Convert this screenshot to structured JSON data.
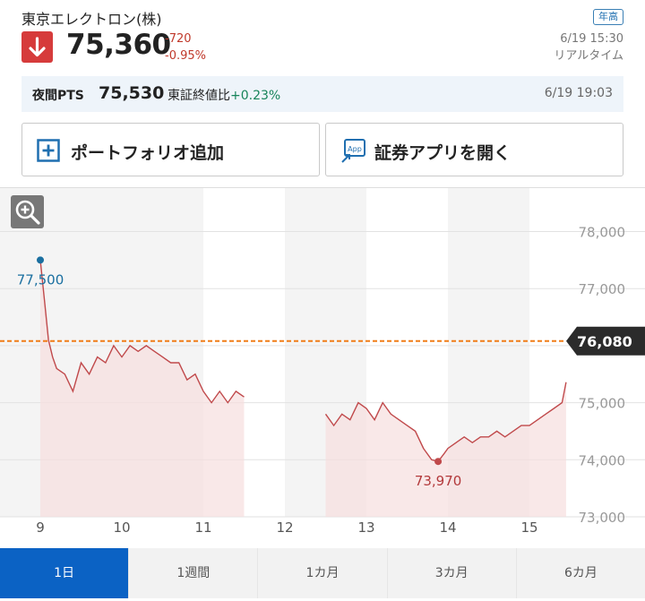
{
  "stock": {
    "name": "東京エレクトロン(株)",
    "badge": "年高",
    "price": "75,360",
    "change": "-720",
    "change_pct": "-0.95%",
    "date": "6/19 15:30",
    "realtime": "リアルタイム"
  },
  "pts": {
    "label": "夜間PTS",
    "price": "75,530",
    "compare_label": "東証終値比",
    "compare_value": "+0.23%",
    "datetime": "6/19 19:03"
  },
  "buttons": {
    "portfolio": "ポートフォリオ追加",
    "app": "証券アプリを開く",
    "app_icon_text": "App"
  },
  "colors": {
    "down": "#d63b3b",
    "up": "#17845a",
    "accent": "#0b62c4",
    "line": "#c0494b",
    "ref": "#f07d18"
  },
  "chart_data": {
    "type": "line",
    "x_labels": [
      "9",
      "10",
      "11",
      "12",
      "13",
      "14",
      "15"
    ],
    "y_ticks": [
      78000,
      77000,
      76000,
      75000,
      74000,
      73000
    ],
    "y_tick_labels": [
      "78,000",
      "77,000",
      "",
      "75,000",
      "74,000",
      "73,000"
    ],
    "ylim": [
      73000,
      78400
    ],
    "reference_line": {
      "value": 76080,
      "label": "76,080"
    },
    "high": {
      "value": 77500,
      "label": "77,500",
      "x": 9.0
    },
    "low": {
      "value": 73970,
      "label": "73,970",
      "x": 13.88
    },
    "morning_session": [
      [
        9.0,
        77500
      ],
      [
        9.05,
        76800
      ],
      [
        9.1,
        76100
      ],
      [
        9.15,
        75800
      ],
      [
        9.2,
        75600
      ],
      [
        9.3,
        75500
      ],
      [
        9.4,
        75200
      ],
      [
        9.5,
        75700
      ],
      [
        9.6,
        75500
      ],
      [
        9.7,
        75800
      ],
      [
        9.8,
        75700
      ],
      [
        9.9,
        76000
      ],
      [
        10.0,
        75800
      ],
      [
        10.1,
        76000
      ],
      [
        10.2,
        75900
      ],
      [
        10.3,
        76000
      ],
      [
        10.4,
        75900
      ],
      [
        10.5,
        75800
      ],
      [
        10.6,
        75700
      ],
      [
        10.7,
        75700
      ],
      [
        10.8,
        75400
      ],
      [
        10.9,
        75500
      ],
      [
        11.0,
        75200
      ],
      [
        11.1,
        75000
      ],
      [
        11.2,
        75200
      ],
      [
        11.3,
        75000
      ],
      [
        11.4,
        75200
      ],
      [
        11.5,
        75100
      ]
    ],
    "afternoon_session": [
      [
        12.5,
        74800
      ],
      [
        12.6,
        74600
      ],
      [
        12.7,
        74800
      ],
      [
        12.8,
        74700
      ],
      [
        12.9,
        75000
      ],
      [
        13.0,
        74900
      ],
      [
        13.1,
        74700
      ],
      [
        13.2,
        75000
      ],
      [
        13.3,
        74800
      ],
      [
        13.4,
        74700
      ],
      [
        13.5,
        74600
      ],
      [
        13.6,
        74500
      ],
      [
        13.7,
        74200
      ],
      [
        13.8,
        74000
      ],
      [
        13.88,
        73970
      ],
      [
        13.95,
        74100
      ],
      [
        14.0,
        74200
      ],
      [
        14.1,
        74300
      ],
      [
        14.2,
        74400
      ],
      [
        14.3,
        74300
      ],
      [
        14.4,
        74400
      ],
      [
        14.5,
        74400
      ],
      [
        14.6,
        74500
      ],
      [
        14.7,
        74400
      ],
      [
        14.8,
        74500
      ],
      [
        14.9,
        74600
      ],
      [
        15.0,
        74600
      ],
      [
        15.1,
        74700
      ],
      [
        15.2,
        74800
      ],
      [
        15.3,
        74900
      ],
      [
        15.4,
        75000
      ],
      [
        15.45,
        75360
      ]
    ]
  },
  "tabs": [
    "1日",
    "1週間",
    "1カ月",
    "3カ月",
    "6カ月"
  ]
}
